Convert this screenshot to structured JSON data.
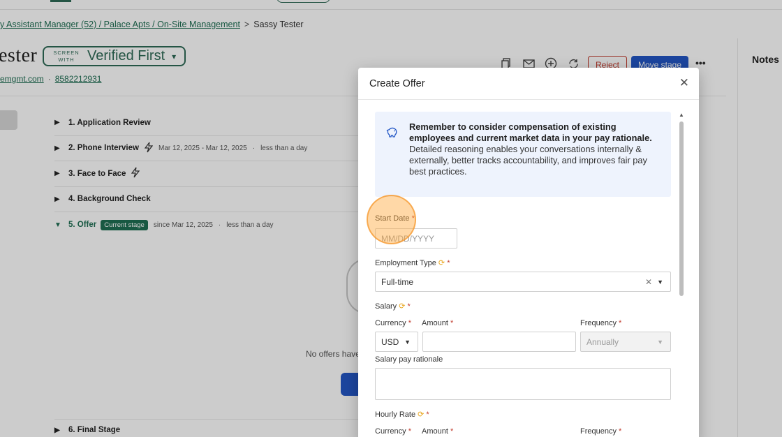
{
  "breadcrumb": {
    "job_link": "y Assistant Manager (52) / Palace Apts / On-Site Management",
    "separator": ">",
    "current": "Sassy Tester"
  },
  "candidate": {
    "name_fragment": "ester",
    "email_fragment": "emgmt.com",
    "phone": "8582212931",
    "dot": "·"
  },
  "verified_first": {
    "screen_line1": "SCREEN",
    "screen_line2": "WITH",
    "brand": "Verified First",
    "caret": "▾"
  },
  "toolbar": {
    "reject_label": "Reject",
    "move_stage_label": "Move stage",
    "more_label": "•••"
  },
  "stages": [
    {
      "title": "1. Application Review",
      "dates": "",
      "duration": "",
      "badge": "",
      "bolt": false
    },
    {
      "title": "2. Phone Interview",
      "dates": "Mar 12, 2025 - Mar 12, 2025",
      "duration": "less than a day",
      "badge": "",
      "bolt": true
    },
    {
      "title": "3. Face to Face",
      "dates": "",
      "duration": "",
      "badge": "",
      "bolt": true
    },
    {
      "title": "4. Background Check",
      "dates": "",
      "duration": "",
      "badge": "",
      "bolt": false
    },
    {
      "title": "5. Offer",
      "dates": "since Mar 12, 2025",
      "duration": "less than a day",
      "badge": "Current stage",
      "bolt": false
    }
  ],
  "stage6_title": "6. Final Stage",
  "offers": {
    "empty_text": "No offers have"
  },
  "notes": {
    "title": "Notes"
  },
  "modal": {
    "title": "Create Offer",
    "close": "✕",
    "callout": {
      "strong": "Remember to consider compensation of existing employees and current market data in your pay rationale.",
      "body": "Detailed reasoning enables your conversations internally & externally, better tracks accountability, and improves fair pay best practices."
    },
    "start_date": {
      "label": "Start Date",
      "required": "*",
      "placeholder": "MM/DD/YYYY"
    },
    "employment_type": {
      "label": "Employment Type",
      "required": "*",
      "value": "Full-time"
    },
    "salary": {
      "label": "Salary",
      "required": "*",
      "currency_label": "Currency",
      "amount_label": "Amount",
      "frequency_label": "Frequency",
      "currency_value": "USD",
      "amount_value": "",
      "frequency_value": "Annually",
      "rationale_label": "Salary pay rationale"
    },
    "hourly_rate": {
      "label": "Hourly Rate",
      "required": "*",
      "currency_label": "Currency",
      "amount_label": "Amount",
      "frequency_label": "Frequency"
    }
  },
  "colors": {
    "brand_green": "#1f6e53",
    "primary_blue": "#2357c6",
    "danger_red": "#c0392b",
    "callout_bg": "#eef3fd",
    "sync_orange": "#e8a41a"
  }
}
